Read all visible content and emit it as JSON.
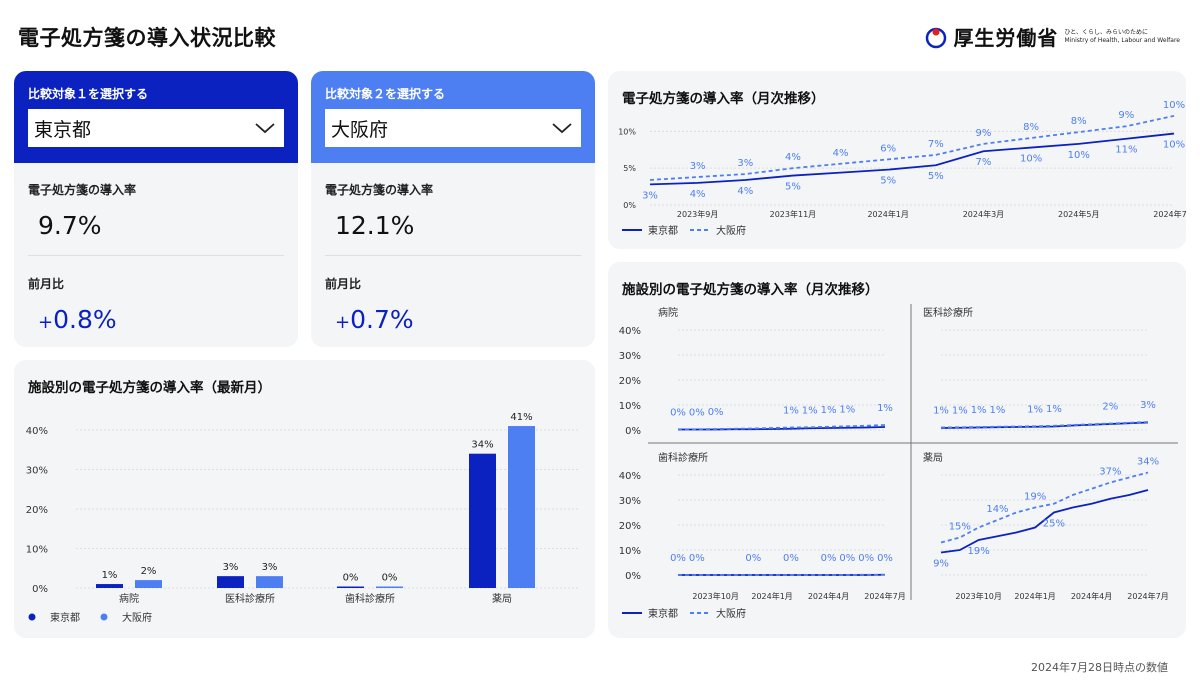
{
  "page_title": "電子処方箋の導入状況比較",
  "logo": {
    "name": "厚生労働省",
    "tagline": "ひと、くらし、みらいのために",
    "english": "Ministry of Health, Labour and Welfare"
  },
  "selector1": {
    "label": "比較対象１を選択する",
    "value": "東京都",
    "color": "#0b22c0"
  },
  "selector2": {
    "label": "比較対象２を選択する",
    "value": "大阪府",
    "color": "#4d7ff3"
  },
  "metrics1": {
    "rate_label": "電子処方箋の導入率",
    "rate_value": "9.7%",
    "mom_label": "前月比",
    "mom_sign": "+",
    "mom_value": "0.8%"
  },
  "metrics2": {
    "rate_label": "電子処方箋の導入率",
    "rate_value": "12.1%",
    "mom_label": "前月比",
    "mom_sign": "+",
    "mom_value": "0.7%"
  },
  "titles": {
    "bar": "施設別の電子処方箋の導入率（最新月）",
    "line": "電子処方箋の導入率（月次推移）",
    "facet": "施設別の電子処方箋の導入率（月次推移）"
  },
  "legend": {
    "s1": "東京都",
    "s2": "大阪府"
  },
  "footer": "2024年7月28日時点の数値",
  "colors": {
    "s1": "#0b22c0",
    "s2": "#4d7ff3"
  },
  "chart_data": [
    {
      "type": "bar",
      "title": "施設別の電子処方箋の導入率（最新月）",
      "categories": [
        "病院",
        "医科診療所",
        "歯科診療所",
        "薬局"
      ],
      "series": [
        {
          "name": "東京都",
          "values": [
            1,
            3,
            0,
            34
          ],
          "labels": [
            "1%",
            "3%",
            "0%",
            "34%"
          ]
        },
        {
          "name": "大阪府",
          "values": [
            2,
            3,
            0,
            41
          ],
          "labels": [
            "2%",
            "3%",
            "0%",
            "41%"
          ]
        }
      ],
      "yticks": [
        "0%",
        "10%",
        "20%",
        "30%",
        "40%"
      ],
      "ylim": [
        0,
        40
      ],
      "legend": "bottom-left"
    },
    {
      "type": "line",
      "title": "電子処方箋の導入率（月次推移）",
      "x": [
        "2023年8月",
        "2023年9月",
        "2023年10月",
        "2023年11月",
        "2023年12月",
        "2024年1月",
        "2024年2月",
        "2024年3月",
        "2024年4月",
        "2024年5月",
        "2024年6月",
        "2024年7月"
      ],
      "xticks": [
        "2023年9月",
        "2023年11月",
        "2024年1月",
        "2024年3月",
        "2024年5月",
        "2024年7月"
      ],
      "series": [
        {
          "name": "東京都",
          "style": "solid",
          "values": [
            2.8,
            3.0,
            3.4,
            4.0,
            4.4,
            4.8,
            5.4,
            7.3,
            7.8,
            8.3,
            9.0,
            9.7
          ],
          "labels": [
            "3%",
            "4%",
            "4%",
            "5%",
            "",
            "5%",
            "5%",
            "7%",
            "10%",
            "10%",
            "11%",
            "10%"
          ]
        },
        {
          "name": "大阪府",
          "style": "dashed",
          "values": [
            3.4,
            3.8,
            4.2,
            5.0,
            5.6,
            6.2,
            6.8,
            8.3,
            9.1,
            9.9,
            10.7,
            12.1
          ],
          "labels": [
            "",
            "3%",
            "3%",
            "4%",
            "4%",
            "6%",
            "7%",
            "9%",
            "8%",
            "8%",
            "9%",
            "10%"
          ]
        }
      ],
      "yticks": [
        "0%",
        "5%",
        "10%"
      ],
      "ylim": [
        0,
        11
      ],
      "legend": "bottom-left"
    },
    {
      "type": "line",
      "title": "施設別の電子処方箋の導入率（月次推移）",
      "x": [
        "2023年8月",
        "2023年9月",
        "2023年10月",
        "2023年11月",
        "2023年12月",
        "2024年1月",
        "2024年2月",
        "2024年3月",
        "2024年4月",
        "2024年5月",
        "2024年6月",
        "2024年7月"
      ],
      "xticks": [
        "2023年10月",
        "2024年1月",
        "2024年4月",
        "2024年7月"
      ],
      "yticks": [
        "0%",
        "10%",
        "20%",
        "30%",
        "40%"
      ],
      "ylim": [
        0,
        40
      ],
      "legend": "bottom-left",
      "facets": [
        {
          "name": "病院",
          "series": [
            {
              "name": "東京都",
              "values": [
                0.2,
                0.2,
                0.2,
                0.3,
                0.3,
                0.4,
                0.5,
                0.7,
                0.8,
                0.9,
                1.0,
                1.2
              ]
            },
            {
              "name": "大阪府",
              "values": [
                0.3,
                0.3,
                0.4,
                0.5,
                0.6,
                0.8,
                1.0,
                1.1,
                1.3,
                1.5,
                1.7,
                2.0
              ]
            }
          ],
          "labels": [
            [
              "0%",
              0
            ],
            [
              "0%",
              1
            ],
            [
              "0%",
              2
            ],
            [
              "1%",
              6
            ],
            [
              "1%",
              7
            ],
            [
              "1%",
              8
            ],
            [
              "1%",
              9
            ],
            [
              "1%",
              11
            ]
          ]
        },
        {
          "name": "医科診療所",
          "series": [
            {
              "name": "東京都",
              "values": [
                0.8,
                0.9,
                1.0,
                1.1,
                1.2,
                1.3,
                1.4,
                1.8,
                2.1,
                2.4,
                2.7,
                3.0
              ]
            },
            {
              "name": "大阪府",
              "values": [
                1.0,
                1.1,
                1.2,
                1.3,
                1.4,
                1.5,
                1.7,
                2.0,
                2.3,
                2.6,
                2.9,
                3.2
              ]
            }
          ],
          "labels": [
            [
              "1%",
              0
            ],
            [
              "1%",
              1
            ],
            [
              "1%",
              2
            ],
            [
              "1%",
              3
            ],
            [
              "1%",
              5
            ],
            [
              "1%",
              6
            ],
            [
              "2%",
              9
            ],
            [
              "3%",
              11
            ]
          ]
        },
        {
          "name": "歯科診療所",
          "series": [
            {
              "name": "東京都",
              "values": [
                0,
                0,
                0,
                0,
                0,
                0,
                0,
                0,
                0,
                0,
                0,
                0.1
              ]
            },
            {
              "name": "大阪府",
              "values": [
                0,
                0,
                0,
                0,
                0,
                0,
                0,
                0,
                0,
                0,
                0.1,
                0.1
              ]
            }
          ],
          "labels": [
            [
              "0%",
              0
            ],
            [
              "0%",
              1
            ],
            [
              "0%",
              4
            ],
            [
              "0%",
              6
            ],
            [
              "0%",
              8
            ],
            [
              "0%",
              9
            ],
            [
              "0%",
              10
            ],
            [
              "0%",
              11
            ]
          ]
        },
        {
          "name": "薬局",
          "series": [
            {
              "name": "東京都",
              "values": [
                9,
                10,
                14,
                15.5,
                17,
                19,
                25,
                27,
                28.5,
                30.5,
                32,
                34
              ]
            },
            {
              "name": "大阪府",
              "values": [
                13,
                15,
                19,
                22,
                25,
                27,
                28.5,
                32,
                34.5,
                37,
                39,
                41
              ]
            }
          ],
          "labels": [
            [
              "9%",
              0
            ],
            [
              "15%",
              1
            ],
            [
              "19%",
              2
            ],
            [
              "14%",
              3
            ],
            [
              "19%",
              5
            ],
            [
              "25%",
              6
            ],
            [
              "37%",
              9
            ],
            [
              "34%",
              11
            ]
          ]
        }
      ]
    }
  ]
}
